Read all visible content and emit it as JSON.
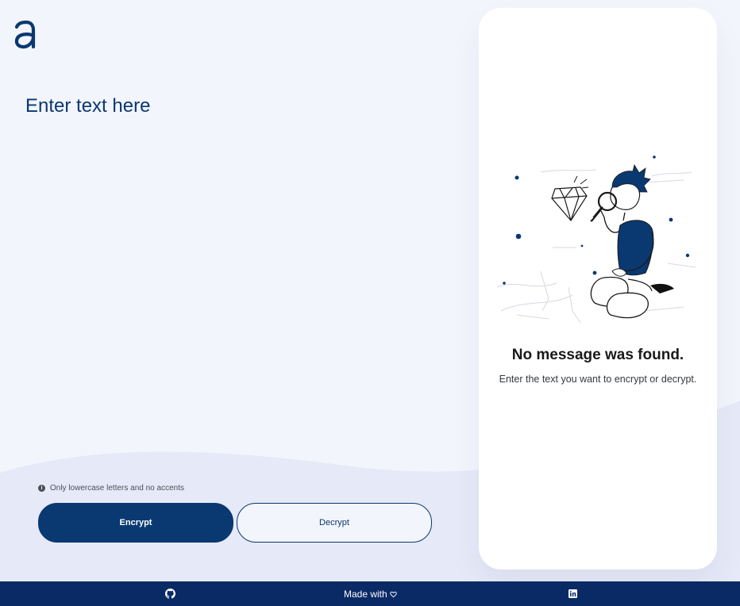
{
  "app": {
    "logo_icon": "letter-a-logo-icon"
  },
  "editor": {
    "placeholder": "Enter text here"
  },
  "hint": {
    "icon": "info-icon",
    "text": "Only lowercase letters and no accents"
  },
  "actions": {
    "encrypt_label": "Encrypt",
    "decrypt_label": "Decrypt"
  },
  "result_panel": {
    "illustration": "person-searching-diamond-illustration",
    "title": "No message was found.",
    "subtitle": "Enter the text you want to encrypt or decrypt."
  },
  "footer": {
    "github_icon": "github-icon",
    "made_with": "Made with",
    "heart_icon": "heart-icon",
    "linkedin_icon": "linkedin-icon"
  },
  "colors": {
    "primary": "#0a3871",
    "footer_bg": "#0a2a66",
    "page_bg": "#f3f5fc",
    "wave_bg": "#e6e9f7",
    "panel_bg": "#ffffff"
  }
}
